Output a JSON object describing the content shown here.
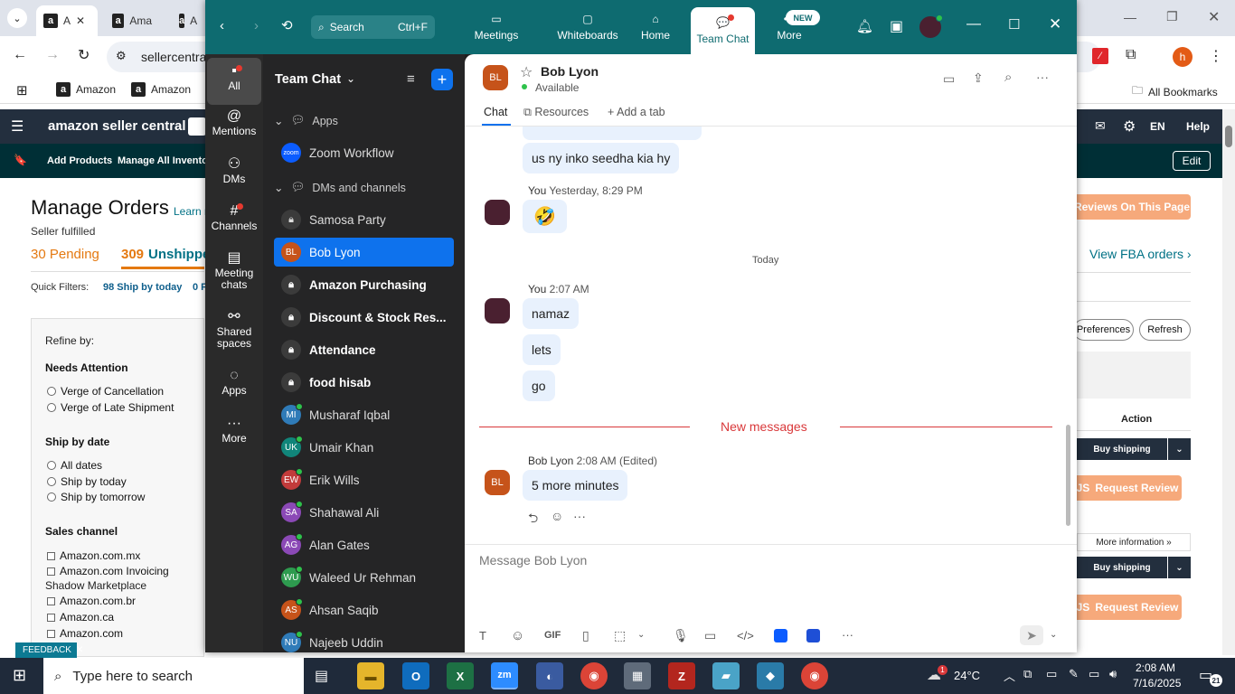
{
  "browser": {
    "tabs": [
      {
        "label": "A"
      },
      {
        "label": "Ama"
      },
      {
        "label": "A"
      }
    ],
    "address": "sellercentra",
    "bookmarks": [
      "Amazon",
      "Amazon"
    ],
    "all_bookmarks": "All Bookmarks",
    "profile_initial": "h"
  },
  "seller": {
    "logo": "amazon seller central",
    "nav_right": [
      "EN",
      "Help"
    ],
    "subnav": [
      "Add Products",
      "Manage All Inventor"
    ],
    "edit": "Edit",
    "title": "Manage Orders",
    "learn": "Learn n",
    "fulfilled": "Seller fulfilled",
    "pending": "30 Pending",
    "unshipped_count": "309",
    "unshipped_label": "Unshippe",
    "quick_filters": "Quick Filters:",
    "qf1": "98 Ship by today",
    "qf2": "0 F",
    "refine": "Refine by:",
    "needs_attention": "Needs Attention",
    "na_opts": [
      "Verge of Cancellation",
      "Verge of Late Shipment"
    ],
    "ship_by": "Ship by date",
    "ship_opts": [
      "All dates",
      "Ship by today",
      "Ship by tomorrow"
    ],
    "sales_channel": "Sales channel",
    "channel_opts": [
      "Amazon.com.mx",
      "Amazon.com Invoicing",
      "Shadow Marketplace",
      "Amazon.com.br",
      "Amazon.ca",
      "Amazon.com"
    ],
    "feedback": "FEEDBACK",
    "reviews_btn": "Reviews On This Page",
    "fba": "View FBA orders",
    "preferences": "Preferences",
    "refresh": "Refresh",
    "action": "Action",
    "buy_shipping": "Buy shipping",
    "request_review": "Request Review",
    "more_info": "More information"
  },
  "zoom": {
    "search": "Search",
    "search_kbd": "Ctrl+F",
    "top_nav": [
      {
        "label": "Meetings"
      },
      {
        "label": "Whiteboards"
      },
      {
        "label": "Home"
      },
      {
        "label": "Team Chat"
      },
      {
        "label": "More"
      }
    ],
    "new_badge": "NEW",
    "rail": [
      {
        "label": "All"
      },
      {
        "label": "Mentions"
      },
      {
        "label": "DMs"
      },
      {
        "label": "Channels"
      },
      {
        "label": "Meeting chats"
      },
      {
        "label": "Shared spaces"
      },
      {
        "label": "Apps"
      },
      {
        "label": "More"
      }
    ],
    "panel_title": "Team Chat",
    "apps_section": "Apps",
    "workflow": "Zoom Workflow",
    "dm_section": "DMs and channels",
    "channels": [
      {
        "name": "Samosa Party",
        "type": "lock"
      },
      {
        "name": "Bob Lyon",
        "type": "avatar",
        "initials": "BL",
        "color": "#c6531a"
      },
      {
        "name": "Amazon Purchasing",
        "type": "lock",
        "bold": true
      },
      {
        "name": "Discount & Stock Res...",
        "type": "lock",
        "bold": true
      },
      {
        "name": "Attendance",
        "type": "lock",
        "bold": true
      },
      {
        "name": "food hisab",
        "type": "lock",
        "bold": true
      },
      {
        "name": "Musharaf Iqbal",
        "type": "avatar",
        "initials": "MI",
        "color": "#2f7bb8"
      },
      {
        "name": "Umair Khan",
        "type": "avatar",
        "initials": "UK",
        "color": "#11857a"
      },
      {
        "name": "Erik Wills",
        "type": "avatar",
        "initials": "EW",
        "color": "#c23b3b"
      },
      {
        "name": "Shahawal Ali",
        "type": "avatar",
        "initials": "SA",
        "color": "#8b49b6"
      },
      {
        "name": "Alan Gates",
        "type": "avatar",
        "initials": "AG",
        "color": "#8b49b6"
      },
      {
        "name": "Waleed Ur Rehman",
        "type": "avatar",
        "initials": "WU",
        "color": "#2e9b4f"
      },
      {
        "name": "Ahsan Saqib",
        "type": "avatar",
        "initials": "AS",
        "color": "#c6531a"
      },
      {
        "name": "Najeeb Uddin",
        "type": "avatar",
        "initials": "NU",
        "color": "#2f7bb8"
      }
    ],
    "contact": {
      "initials": "BL",
      "name": "Bob Lyon",
      "status": "Available"
    },
    "tabs": [
      "Chat",
      "Resources",
      "Add a tab"
    ],
    "messages": {
      "m0": "us ny inko seedha kia hy",
      "m1_sender": "You",
      "m1_time": "Yesterday, 8:29 PM",
      "m1_text": "🤣",
      "today": "Today",
      "m2_sender": "You",
      "m2_time": "2:07 AM",
      "m2_texts": [
        "namaz",
        "lets",
        "go"
      ],
      "new_messages": "New messages",
      "m3_sender": "Bob Lyon",
      "m3_time": "2:08 AM",
      "m3_edited": "(Edited)",
      "m3_text": "5 more minutes"
    },
    "input_placeholder": "Message Bob Lyon"
  },
  "taskbar": {
    "search": "Type here to search",
    "weather": "24°C",
    "time": "2:08 AM",
    "date": "7/16/2025",
    "notif": "21"
  }
}
